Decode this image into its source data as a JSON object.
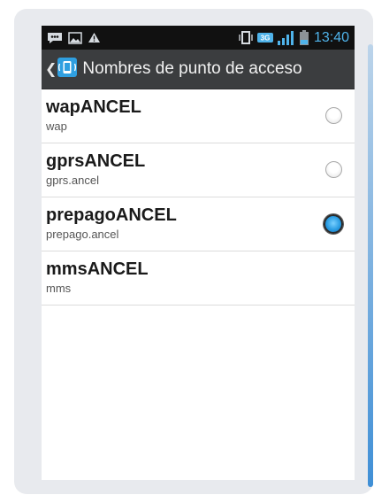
{
  "status_bar": {
    "time": "13:40",
    "network_badge": "3G",
    "icons": [
      "message-icon",
      "image-icon",
      "warning-icon",
      "vibrate-icon",
      "signal-icon",
      "battery-icon"
    ]
  },
  "action_bar": {
    "title": "Nombres de punto de acceso",
    "icon": "apn-settings-icon"
  },
  "apn_list": [
    {
      "name": "wapANCEL",
      "apn": "wap",
      "selected": false
    },
    {
      "name": "gprsANCEL",
      "apn": "gprs.ancel",
      "selected": false
    },
    {
      "name": "prepagoANCEL",
      "apn": "prepago.ancel",
      "selected": true
    },
    {
      "name": "mmsANCEL",
      "apn": "mms"
    }
  ],
  "colors": {
    "accent": "#2b9de3",
    "clock": "#4fb3ea",
    "action_bar": "#3b3d3f",
    "status_bar": "#111111"
  }
}
